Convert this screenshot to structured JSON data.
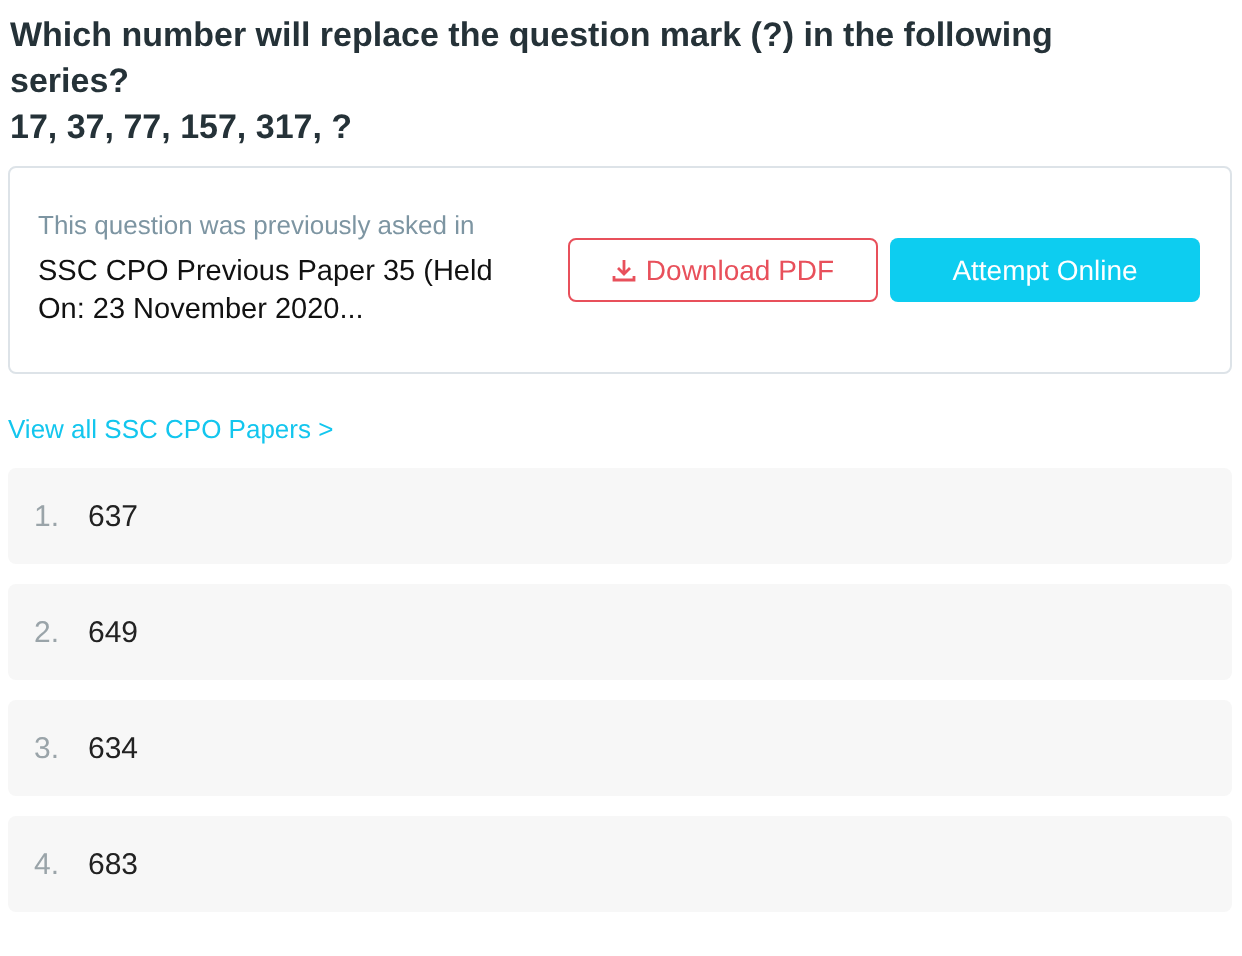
{
  "question": {
    "text": "Which number will replace the question mark (?) in the following series?",
    "series": "17, 37, 77, 157, 317, ?"
  },
  "source": {
    "caption": "This question was previously asked in",
    "paper": "SSC CPO Previous Paper 35 (Held On: 23 November 2020...",
    "download_button": "Download PDF",
    "attempt_button": "Attempt Online"
  },
  "view_all_link": "View all SSC CPO Papers >",
  "options": [
    {
      "number": "1.",
      "text": "637"
    },
    {
      "number": "2.",
      "text": "649"
    },
    {
      "number": "3.",
      "text": "634"
    },
    {
      "number": "4.",
      "text": "683"
    }
  ]
}
